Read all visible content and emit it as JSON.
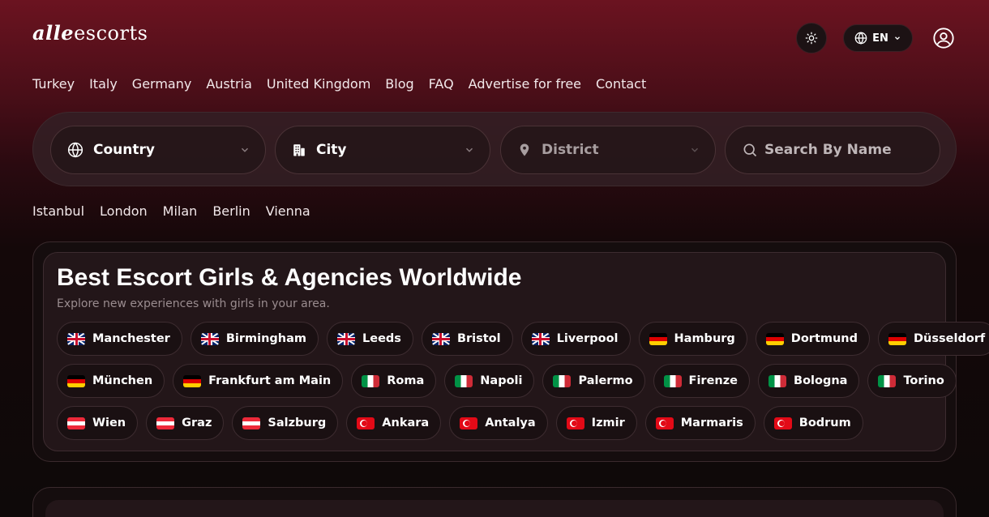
{
  "brand": {
    "logo_script": "alle",
    "logo_text": "escorts"
  },
  "header": {
    "lang_label": "EN"
  },
  "nav": [
    "Turkey",
    "Italy",
    "Germany",
    "Austria",
    "United Kingdom",
    "Blog",
    "FAQ",
    "Advertise for free",
    "Contact"
  ],
  "search": {
    "country_label": "Country",
    "city_label": "City",
    "district_label": "District",
    "name_placeholder": "Search By Name"
  },
  "quick_cities": [
    "Istanbul",
    "London",
    "Milan",
    "Berlin",
    "Vienna"
  ],
  "section": {
    "title": "Best Escort Girls & Agencies Worldwide",
    "subtitle": "Explore new experiences with girls in your area.",
    "city_rows": [
      [
        {
          "flag": "uk",
          "name": "Manchester"
        },
        {
          "flag": "uk",
          "name": "Birmingham"
        },
        {
          "flag": "uk",
          "name": "Leeds"
        },
        {
          "flag": "uk",
          "name": "Bristol"
        },
        {
          "flag": "uk",
          "name": "Liverpool"
        },
        {
          "flag": "de",
          "name": "Hamburg"
        },
        {
          "flag": "de",
          "name": "Dortmund"
        },
        {
          "flag": "de",
          "name": "Düsseldorf"
        }
      ],
      [
        {
          "flag": "de",
          "name": "München"
        },
        {
          "flag": "de",
          "name": "Frankfurt am Main"
        },
        {
          "flag": "it",
          "name": "Roma"
        },
        {
          "flag": "it",
          "name": "Napoli"
        },
        {
          "flag": "it",
          "name": "Palermo"
        },
        {
          "flag": "it",
          "name": "Firenze"
        },
        {
          "flag": "it",
          "name": "Bologna"
        },
        {
          "flag": "it",
          "name": "Torino"
        }
      ],
      [
        {
          "flag": "at",
          "name": "Wien"
        },
        {
          "flag": "at",
          "name": "Graz"
        },
        {
          "flag": "at",
          "name": "Salzburg"
        },
        {
          "flag": "tr",
          "name": "Ankara"
        },
        {
          "flag": "tr",
          "name": "Antalya"
        },
        {
          "flag": "tr",
          "name": "Izmir"
        },
        {
          "flag": "tr",
          "name": "Marmaris"
        },
        {
          "flag": "tr",
          "name": "Bodrum"
        }
      ]
    ]
  },
  "icons": {
    "theme": "sun-icon",
    "language": "globe-icon",
    "user": "user-circle-icon",
    "country": "globe-icon",
    "city": "building-icon",
    "district": "map-pin-icon",
    "search": "search-icon"
  },
  "colors": {
    "accent": "#6b1320",
    "background": "#0e0909",
    "panel": "#231619"
  }
}
